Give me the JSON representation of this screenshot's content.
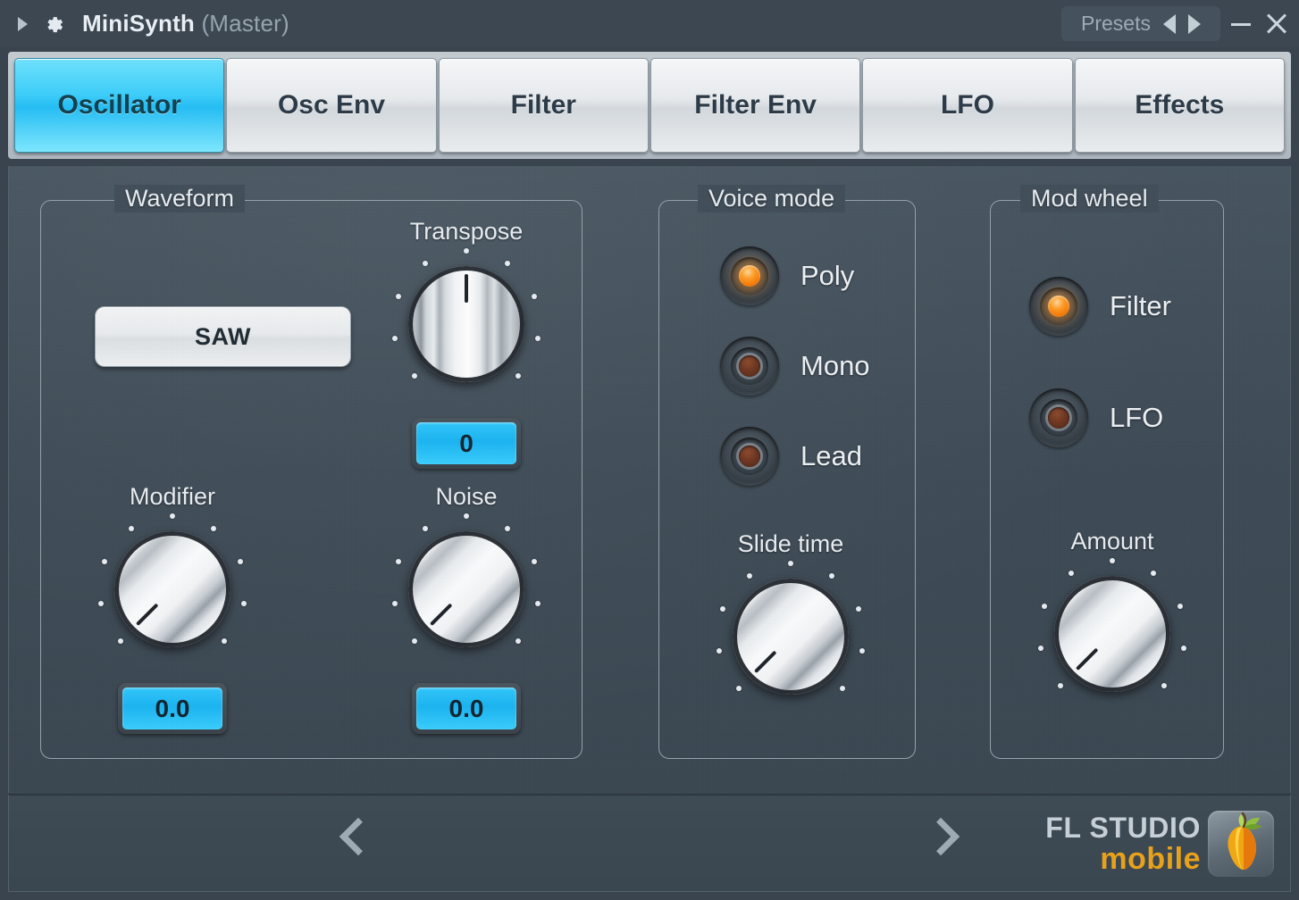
{
  "titlebar": {
    "expand_icon": "triangle-right-icon",
    "gear_icon": "gear-icon",
    "title": "MiniSynth",
    "subtitle": "(Master)",
    "presets_label": "Presets",
    "presets_prev_icon": "triangle-left-icon",
    "presets_next_icon": "triangle-right-icon",
    "minimize_icon": "minimize-icon",
    "close_icon": "close-icon"
  },
  "tabs": [
    {
      "label": "Oscillator",
      "active": true
    },
    {
      "label": "Osc Env",
      "active": false
    },
    {
      "label": "Filter",
      "active": false
    },
    {
      "label": "Filter Env",
      "active": false
    },
    {
      "label": "LFO",
      "active": false
    },
    {
      "label": "Effects",
      "active": false
    }
  ],
  "groups": {
    "waveform": {
      "legend": "Waveform",
      "select": {
        "value": "SAW",
        "caret_icon": "chevron-down-icon"
      },
      "transpose": {
        "label": "Transpose",
        "value": "0",
        "angle_deg": 0
      },
      "modifier": {
        "label": "Modifier",
        "value": "0.0",
        "angle_deg": -135
      },
      "noise": {
        "label": "Noise",
        "value": "0.0",
        "angle_deg": -135
      }
    },
    "voice_mode": {
      "legend": "Voice mode",
      "options": [
        {
          "label": "Poly",
          "selected": true
        },
        {
          "label": "Mono",
          "selected": false
        },
        {
          "label": "Lead",
          "selected": false
        }
      ],
      "slide_time": {
        "label": "Slide time",
        "angle_deg": -135
      }
    },
    "mod_wheel": {
      "legend": "Mod wheel",
      "options": [
        {
          "label": "Filter",
          "selected": true
        },
        {
          "label": "LFO",
          "selected": false
        }
      ],
      "amount": {
        "label": "Amount",
        "angle_deg": -135
      }
    }
  },
  "footer": {
    "prev_icon": "chevron-left-icon",
    "next_icon": "chevron-right-icon",
    "brand_top": "FL STUDIO",
    "brand_bottom": "mobile",
    "brand_mark_icon": "fl-fruit-icon"
  },
  "colors": {
    "accent_cyan": "#25bdf3",
    "led_on": "#ff8c18",
    "led_off": "#6d3620",
    "panel_bg": "#3d4a55",
    "brand_orange": "#e8a11b"
  }
}
